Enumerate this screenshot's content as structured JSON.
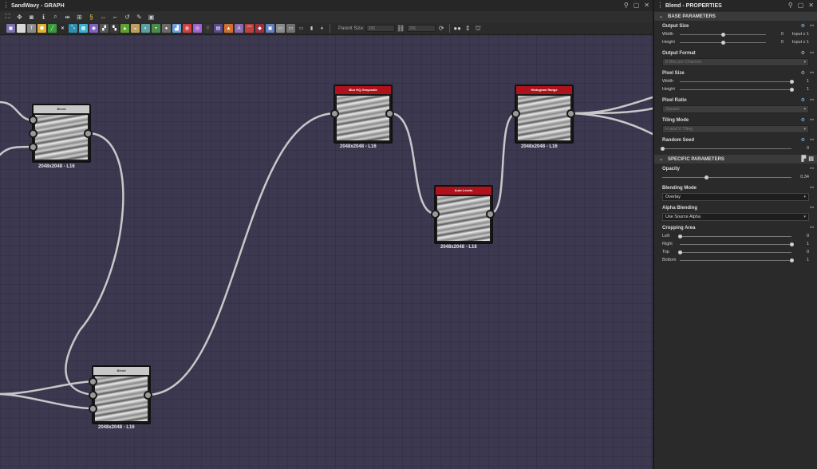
{
  "graph": {
    "title": "SandWavy - GRAPH",
    "toolbar": {
      "parent_size_label": "Parent Size:",
      "parent_size_value": "256",
      "size_value": "256"
    },
    "nodes": [
      {
        "id": "blend1",
        "title": "Blend",
        "caption": "2048x2048 - L16",
        "header_color": "grey"
      },
      {
        "id": "blur",
        "title": "Blur HQ Grayscale",
        "caption": "2048x2048 - L16",
        "header_color": "red"
      },
      {
        "id": "hist",
        "title": "Histogram Range",
        "caption": "2048x2048 - L16",
        "header_color": "red"
      },
      {
        "id": "auto",
        "title": "Auto Levels",
        "caption": "2048x2048 - L16",
        "header_color": "red"
      },
      {
        "id": "blend2",
        "title": "Blend",
        "caption": "2048x2048 - L16",
        "header_color": "grey"
      }
    ]
  },
  "properties": {
    "title": "Blend - PROPERTIES",
    "base_section": "BASE PARAMETERS",
    "output_size": {
      "title": "Output Size",
      "width_label": "Width",
      "width_value": "0",
      "width_extra": "Input x 1",
      "width_level": 0.5,
      "height_label": "Height",
      "height_value": "0",
      "height_extra": "Input x 1",
      "height_level": 0.5
    },
    "output_format": {
      "title": "Output Format",
      "value": "8 Bits per Channel"
    },
    "pixel_size": {
      "title": "Pixel Size",
      "width_label": "Width",
      "width_value": "1",
      "height_label": "Height",
      "height_value": "1"
    },
    "pixel_ratio": {
      "title": "Pixel Ratio",
      "value": "Square"
    },
    "tiling_mode": {
      "title": "Tiling Mode",
      "value": "H and V Tiling"
    },
    "random_seed": {
      "title": "Random Seed",
      "value": "0"
    },
    "specific_section": "SPECIFIC PARAMETERS",
    "opacity": {
      "title": "Opacity",
      "value": "0.34",
      "level": 0.34
    },
    "blending_mode": {
      "title": "Blending Mode",
      "value": "Overlay"
    },
    "alpha_blending": {
      "title": "Alpha Blending",
      "value": "Use Source Alpha"
    },
    "cropping_area": {
      "title": "Cropping Area",
      "left_label": "Left",
      "left_value": "0",
      "right_label": "Right",
      "right_value": "1",
      "top_label": "Top",
      "top_value": "0",
      "bottom_label": "Bottom",
      "bottom_value": "1"
    }
  },
  "colors": {
    "canvas_bg": "#3c3850",
    "node_header_red": "#b0121b",
    "node_header_grey": "#c8c8c8",
    "wire": "#c8c8c8"
  }
}
